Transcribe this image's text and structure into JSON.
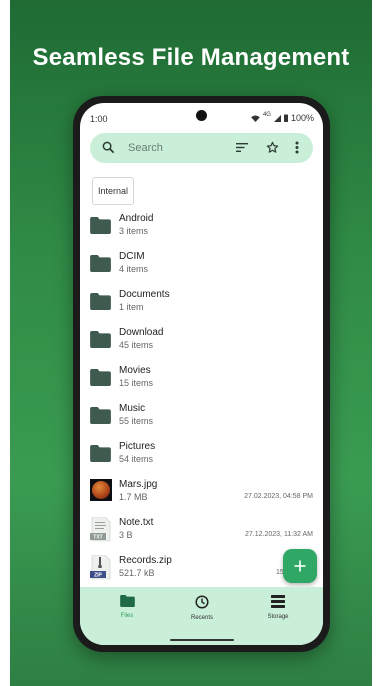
{
  "headline": "Seamless File Management",
  "status": {
    "time": "1:00",
    "network": "4G",
    "battery": "100%"
  },
  "search": {
    "placeholder": "Search"
  },
  "location_chip": "Internal",
  "items": [
    {
      "name": "Android",
      "meta": "3 items",
      "kind": "folder"
    },
    {
      "name": "DCIM",
      "meta": "4 items",
      "kind": "folder"
    },
    {
      "name": "Documents",
      "meta": "1 item",
      "kind": "folder"
    },
    {
      "name": "Download",
      "meta": "45 items",
      "kind": "folder"
    },
    {
      "name": "Movies",
      "meta": "15 items",
      "kind": "folder"
    },
    {
      "name": "Music",
      "meta": "55 items",
      "kind": "folder"
    },
    {
      "name": "Pictures",
      "meta": "54 items",
      "kind": "folder"
    },
    {
      "name": "Mars.jpg",
      "meta": "1.7 MB",
      "date": "27.02.2023, 04:58 PM",
      "kind": "image"
    },
    {
      "name": "Note.txt",
      "meta": "3 B",
      "date": "27.12.2023, 11:32 AM",
      "kind": "txt",
      "badge": "TXT"
    },
    {
      "name": "Records.zip",
      "meta": "521.7 kB",
      "date": "15.07.2023,",
      "kind": "zip",
      "badge": "ZIP"
    }
  ],
  "nav": {
    "files": "Files",
    "recents": "Recents",
    "storage": "Storage"
  },
  "colors": {
    "accent": "#2fa866",
    "bar": "#c9efd9",
    "folder": "#3f5a4e",
    "background": "#2f8a45"
  },
  "icons": [
    "search-icon",
    "sort-icon",
    "star-icon",
    "more-vert-icon",
    "folder-icon",
    "add-icon",
    "clock-icon",
    "storage-icon"
  ]
}
